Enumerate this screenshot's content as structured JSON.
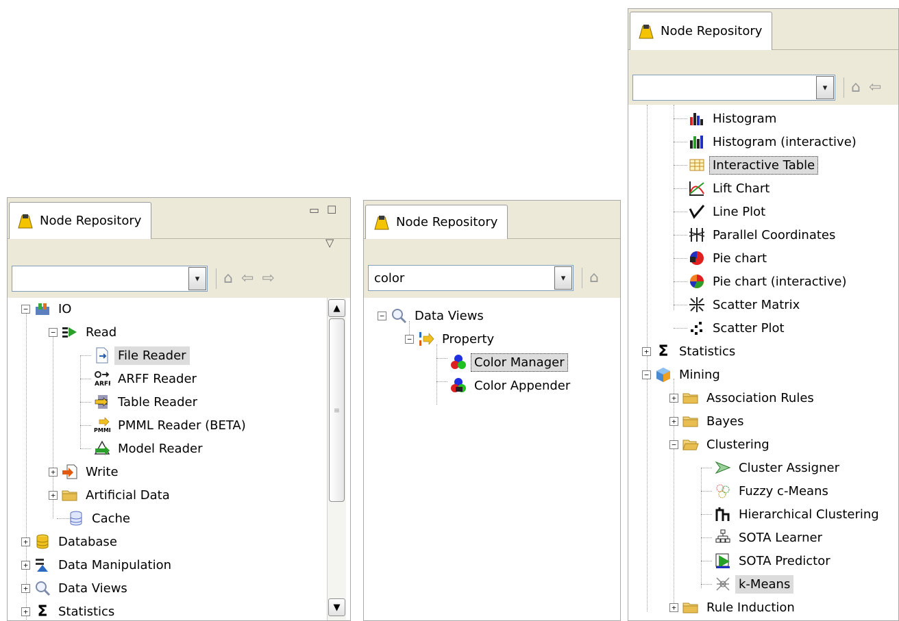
{
  "panels": {
    "left": {
      "tab_title": "Node Repository",
      "search_value": "",
      "tree": [
        {
          "label": "IO",
          "icon": "io-icon"
        },
        {
          "label": "Read",
          "icon": "read-arrow-icon"
        },
        {
          "label": "File Reader",
          "icon": "file-reader-icon"
        },
        {
          "label": "ARFF Reader",
          "icon": "arff-reader-icon"
        },
        {
          "label": "Table Reader",
          "icon": "table-reader-icon"
        },
        {
          "label": "PMML Reader (BETA)",
          "icon": "pmml-reader-icon"
        },
        {
          "label": "Model Reader",
          "icon": "model-reader-icon"
        },
        {
          "label": "Write",
          "icon": "write-icon"
        },
        {
          "label": "Artificial Data",
          "icon": "folder-icon"
        },
        {
          "label": "Cache",
          "icon": "cache-icon"
        },
        {
          "label": "Database",
          "icon": "database-icon"
        },
        {
          "label": "Data Manipulation",
          "icon": "data-manipulation-icon"
        },
        {
          "label": "Data Views",
          "icon": "magnifier-icon"
        },
        {
          "label": "Statistics",
          "icon": "sigma-icon"
        }
      ]
    },
    "middle": {
      "tab_title": "Node Repository",
      "search_value": "color",
      "tree": [
        {
          "label": "Data Views",
          "icon": "magnifier-icon"
        },
        {
          "label": "Property",
          "icon": "property-icon"
        },
        {
          "label": "Color Manager",
          "icon": "color-manager-icon"
        },
        {
          "label": "Color Appender",
          "icon": "color-appender-icon"
        }
      ]
    },
    "right": {
      "tab_title": "Node Repository",
      "search_value": "",
      "tree": [
        {
          "label": "Histogram",
          "icon": "histogram-icon"
        },
        {
          "label": "Histogram (interactive)",
          "icon": "histogram-interactive-icon"
        },
        {
          "label": "Interactive Table",
          "icon": "table-icon"
        },
        {
          "label": "Lift Chart",
          "icon": "lift-chart-icon"
        },
        {
          "label": "Line Plot",
          "icon": "line-plot-icon"
        },
        {
          "label": "Parallel Coordinates",
          "icon": "parallel-coordinates-icon"
        },
        {
          "label": "Pie chart",
          "icon": "pie-chart-icon"
        },
        {
          "label": "Pie chart (interactive)",
          "icon": "pie-chart-interactive-icon"
        },
        {
          "label": "Scatter Matrix",
          "icon": "scatter-matrix-icon"
        },
        {
          "label": "Scatter Plot",
          "icon": "scatter-plot-icon"
        },
        {
          "label": "Statistics",
          "icon": "sigma-icon"
        },
        {
          "label": "Mining",
          "icon": "mining-cube-icon"
        },
        {
          "label": "Association Rules",
          "icon": "folder-icon"
        },
        {
          "label": "Bayes",
          "icon": "folder-icon"
        },
        {
          "label": "Clustering",
          "icon": "folder-open-icon"
        },
        {
          "label": "Cluster Assigner",
          "icon": "cluster-assigner-icon"
        },
        {
          "label": "Fuzzy c-Means",
          "icon": "fuzzy-cmeans-icon"
        },
        {
          "label": "Hierarchical Clustering",
          "icon": "hierarchical-clustering-icon"
        },
        {
          "label": "SOTA Learner",
          "icon": "sota-learner-icon"
        },
        {
          "label": "SOTA Predictor",
          "icon": "sota-predictor-icon"
        },
        {
          "label": "k-Means",
          "icon": "kmeans-icon"
        },
        {
          "label": "Rule Induction",
          "icon": "folder-icon"
        }
      ]
    }
  },
  "glyphs": {
    "expand": "+",
    "collapse": "−",
    "dropdown": "▾",
    "home": "⌂",
    "back": "⇦",
    "forward": "⇨",
    "minimize": "▭",
    "maximize": "☐",
    "view_menu": "▽",
    "scroll_up": "▲",
    "scroll_down": "▼",
    "grip": "≡"
  }
}
